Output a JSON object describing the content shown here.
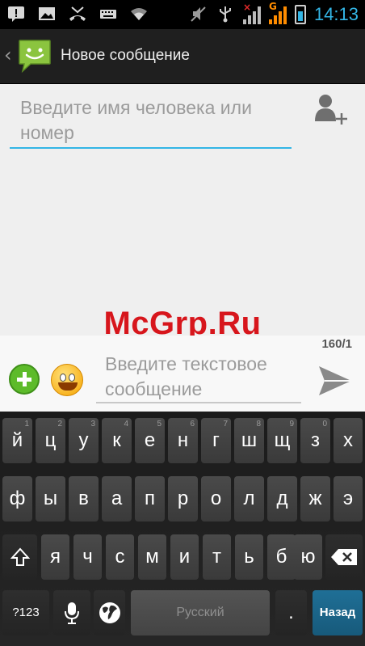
{
  "status_bar": {
    "time": "14:13",
    "left_icons": [
      "notification-icon",
      "image-icon",
      "missed-call-icon",
      "keyboard-icon",
      "wifi-icon"
    ],
    "right_icons": [
      "mute-icon",
      "usb-icon",
      "signal-icon",
      "g-signal-icon",
      "battery-icon"
    ],
    "network_label": "G"
  },
  "action_bar": {
    "title": "Новое сообщение",
    "back_icon": "back-caret-icon",
    "app_icon": "messaging-icon"
  },
  "compose": {
    "recipient_placeholder": "Введите имя человека или номер",
    "add_contact_icon": "add-contact-icon",
    "watermark": "McGrp.Ru"
  },
  "message_bar": {
    "counter": "160/1",
    "message_placeholder": "Введите текстовое сообщение",
    "attach_icon": "attach-plus-icon",
    "emoji_icon": "smiley-icon",
    "send_icon": "send-icon"
  },
  "keyboard": {
    "row1": [
      {
        "label": "й",
        "hint": "1"
      },
      {
        "label": "ц",
        "hint": "2"
      },
      {
        "label": "у",
        "hint": "3"
      },
      {
        "label": "к",
        "hint": "4"
      },
      {
        "label": "е",
        "hint": "5"
      },
      {
        "label": "н",
        "hint": "6"
      },
      {
        "label": "г",
        "hint": "7"
      },
      {
        "label": "ш",
        "hint": "8"
      },
      {
        "label": "щ",
        "hint": "9"
      },
      {
        "label": "з",
        "hint": "0"
      },
      {
        "label": "х",
        "hint": ""
      }
    ],
    "row2": [
      "ф",
      "ы",
      "в",
      "а",
      "п",
      "р",
      "о",
      "л",
      "д",
      "ж",
      "э"
    ],
    "row3": [
      "я",
      "ч",
      "с",
      "м",
      "и",
      "т",
      "ь",
      "б",
      "ю"
    ],
    "shift_icon": "shift-icon",
    "delete_icon": "backspace-icon",
    "symbols_label": "?123",
    "mic_icon": "microphone-icon",
    "globe_icon": "globe-icon",
    "space_label": "Русский",
    "period_label": ".",
    "enter_label": "Назад"
  }
}
